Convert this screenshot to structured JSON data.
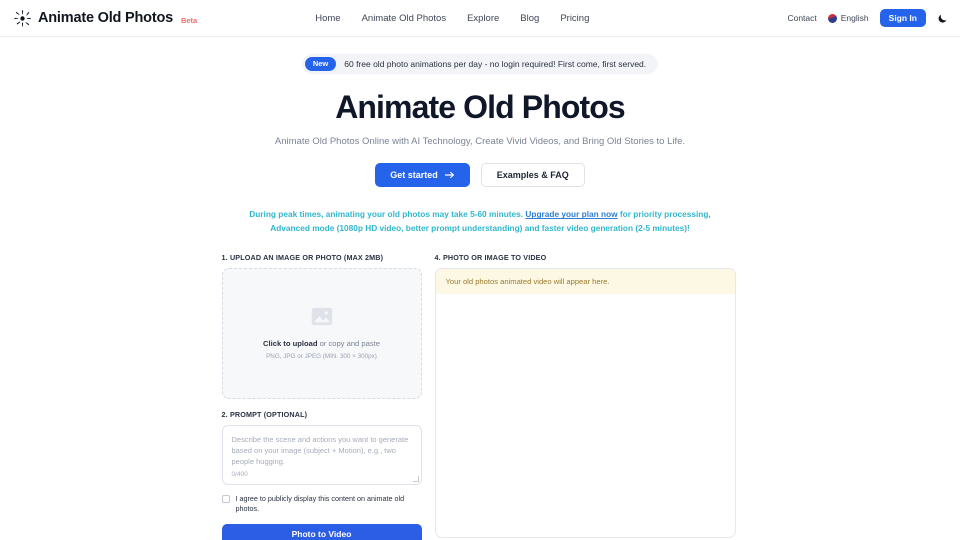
{
  "header": {
    "logo_icon": "sparkle-icon",
    "brand_name": "Animate Old Photos",
    "beta_label": "Beta",
    "nav_links": [
      {
        "label": "Home"
      },
      {
        "label": "Animate Old Photos"
      },
      {
        "label": "Explore"
      },
      {
        "label": "Blog"
      },
      {
        "label": "Pricing"
      }
    ],
    "contact_label": "Contact",
    "language_label": "English",
    "language_flag_icon": "uk-flag-icon",
    "signin_label": "Sign In",
    "theme_toggle_icon": "moon-icon"
  },
  "hero": {
    "banner_pill": "New",
    "banner_text": "60 free old photo animations per day - no login required! First come, first served.",
    "title": "Animate Old Photos",
    "subtitle": "Animate Old Photos Online with AI Technology, Create Vivid Videos, and Bring Old Stories to Life.",
    "primary_cta": "Get started",
    "primary_cta_icon": "arrow-right-icon",
    "secondary_cta": "Examples & FAQ",
    "notice_part1": "During peak times, animating your old photos may take 5-60 minutes. ",
    "notice_link": "Upgrade your plan now",
    "notice_part2": " for priority processing, Advanced mode (1080p HD video, better prompt understanding) and faster video generation (2-5 minutes)!"
  },
  "upload": {
    "section_label": "1. UPLOAD AN IMAGE OR PHOTO (MAX 2MB)",
    "icon": "image-placeholder-icon",
    "main_text_strong": "Click to upload",
    "main_text_rest": " or copy and paste",
    "hint": "PNG, JPG or JPEG (MIN. 300 × 300px)"
  },
  "prompt": {
    "section_label": "2. PROMPT (OPTIONAL)",
    "placeholder": "Describe the scene and actions you want to generate based on your image (subject + Motion), e.g., two people hugging.",
    "char_count": "0/400",
    "agree_text": "I agree to publicly display this content on animate old photos.",
    "submit_label": "Photo to Video"
  },
  "result": {
    "section_label": "4. PHOTO OR IMAGE TO VIDEO",
    "placeholder_text": "Your old photos animated video will appear here."
  },
  "colors": {
    "accent_blue": "#2563eb",
    "submit_blue": "#2c5de5",
    "notice_teal": "#31b7cc",
    "notice_link_blue": "#2f7fd4",
    "beta_red": "#f26d6d",
    "result_header_cream": "#fdf8e3",
    "result_header_text": "#9a7b2e"
  }
}
